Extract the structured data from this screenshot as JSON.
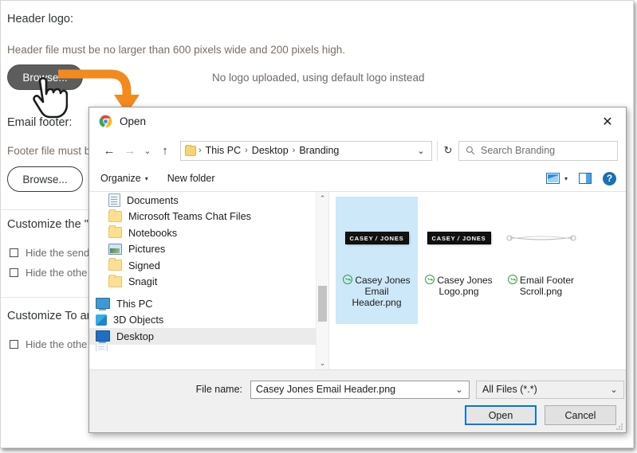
{
  "background_form": {
    "header_logo_label": "Header logo:",
    "header_help": "Header file must be no larger than 600 pixels wide and 200 pixels high.",
    "browse_header_label": "Browse...",
    "no_logo_note": "No logo uploaded, using default logo instead",
    "email_footer_label": "Email footer:",
    "footer_help": "Footer file must b",
    "browse_footer_label": "Browse...",
    "customize_section_1": "Customize the \"",
    "checkbox_1": "Hide the send",
    "checkbox_2": "Hide the othe",
    "customize_section_2": "Customize To ar",
    "checkbox_3": "Hide the othe"
  },
  "dialog": {
    "title": "Open",
    "title_icon": "chrome-icon",
    "close_label": "✕",
    "nav": {
      "back_icon": "←",
      "forward_icon": "→",
      "recent_icon": "⌄",
      "up_icon": "↑",
      "breadcrumbs": [
        "This PC",
        "Desktop",
        "Branding"
      ],
      "breadcrumb_separator": "›",
      "address_dropdown_icon": "⌄",
      "refresh_icon": "↻",
      "search_placeholder": "Search Branding",
      "search_icon": "search-icon"
    },
    "toolbar": {
      "organize_label": "Organize",
      "organize_caret": "▾",
      "new_folder_label": "New folder",
      "view_caret": "▾",
      "icons": [
        "view-mode-icon",
        "preview-pane-icon",
        "help-icon"
      ],
      "help_glyph": "?"
    },
    "nav_pane": {
      "items": [
        {
          "label": "Documents",
          "icon": "document-icon",
          "type": "doc",
          "root": false,
          "selected": false
        },
        {
          "label": "Microsoft Teams Chat Files",
          "icon": "folder-icon",
          "type": "folder",
          "root": false,
          "selected": false
        },
        {
          "label": "Notebooks",
          "icon": "folder-icon",
          "type": "folder",
          "root": false,
          "selected": false
        },
        {
          "label": "Pictures",
          "icon": "pictures-icon",
          "type": "pic",
          "root": false,
          "selected": false
        },
        {
          "label": "Signed",
          "icon": "folder-icon",
          "type": "folder",
          "root": false,
          "selected": false
        },
        {
          "label": "Snagit",
          "icon": "folder-icon",
          "type": "folder",
          "root": false,
          "selected": false
        },
        {
          "label": "This PC",
          "icon": "this-pc-icon",
          "type": "pc",
          "root": true,
          "selected": false
        },
        {
          "label": "3D Objects",
          "icon": "3d-objects-icon",
          "type": "3d",
          "root": true,
          "selected": false
        },
        {
          "label": "Desktop",
          "icon": "desktop-icon",
          "type": "desktop",
          "root": true,
          "selected": true
        }
      ],
      "scroll_up_icon": "⌃",
      "scroll_down_icon": "⌄"
    },
    "files": [
      {
        "name": "Casey Jones Email Header.png",
        "thumb": "logo",
        "logo_text_1": "CASEY",
        "logo_text_2": "JONES",
        "selected": true
      },
      {
        "name": "Casey Jones Logo.png",
        "thumb": "logo",
        "logo_text_1": "CASEY",
        "logo_text_2": "JONES",
        "selected": false
      },
      {
        "name": "Email Footer Scroll.png",
        "thumb": "scroll",
        "logo_text_1": "",
        "logo_text_2": "",
        "selected": false
      }
    ],
    "footer": {
      "filename_label": "File name:",
      "filename_value": "Casey Jones Email Header.png",
      "filename_caret": "⌄",
      "filetype_value": "All Files (*.*)",
      "filetype_caret": "⌄",
      "open_label": "Open",
      "cancel_label": "Cancel"
    }
  },
  "annotation": {
    "arrow_color": "#f28a1e",
    "cursor": "hand-pointer-cursor"
  }
}
